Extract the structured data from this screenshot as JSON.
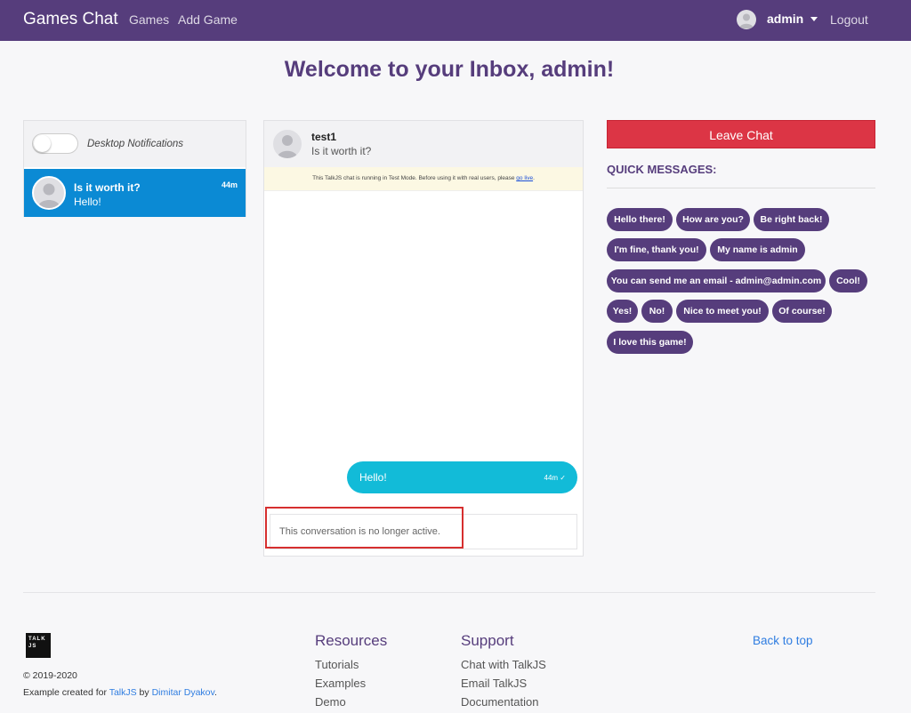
{
  "navbar": {
    "brand": "Games Chat",
    "links": [
      "Games",
      "Add Game"
    ],
    "user": "admin",
    "logout": "Logout",
    "color": "#563d7c"
  },
  "page": {
    "title": "Welcome to your Inbox, admin!"
  },
  "inbox": {
    "notifications_label": "Desktop Notifications",
    "notifications_enabled": false,
    "conversation": {
      "title": "Is it worth it?",
      "last_message": "Hello!",
      "time": "44m"
    }
  },
  "chat": {
    "participant": "test1",
    "subject": "Is it worth it?",
    "test_mode_notice": "This TalkJS chat is running in Test Mode. Before using it with real users, please",
    "test_mode_link": "go live",
    "test_mode_end": ".",
    "message": {
      "text": "Hello!",
      "time": "44m ✓"
    },
    "inactive_notice": "This conversation is no longer active."
  },
  "actions": {
    "leave_label": "Leave Chat",
    "quick_title": "QUICK MESSAGES:",
    "quick_messages": [
      "Hello there!",
      "How are you?",
      "Be right back!",
      "I'm fine, thank you!",
      "My name is admin",
      "You can send me an email - admin@admin.com",
      "Cool!",
      "Yes!",
      "No!",
      "Nice to meet you!",
      "Of course!",
      "I love this game!"
    ]
  },
  "footer": {
    "logo_text": [
      "TALK",
      "JS"
    ],
    "copyright": "© 2019-2020",
    "credit_prefix": "Example created for ",
    "credit_link1": "TalkJS",
    "credit_mid": " by ",
    "credit_link2": "Dimitar Dyakov",
    "credit_suffix": ".",
    "resources": {
      "title": "Resources",
      "links": [
        "Tutorials",
        "Examples",
        "Demo"
      ]
    },
    "support": {
      "title": "Support",
      "links": [
        "Chat with TalkJS",
        "Email TalkJS",
        "Documentation"
      ]
    },
    "back_to_top": "Back to top"
  },
  "icons": [
    "avatar-icon",
    "caret-down-icon",
    "talkjs-logo"
  ]
}
